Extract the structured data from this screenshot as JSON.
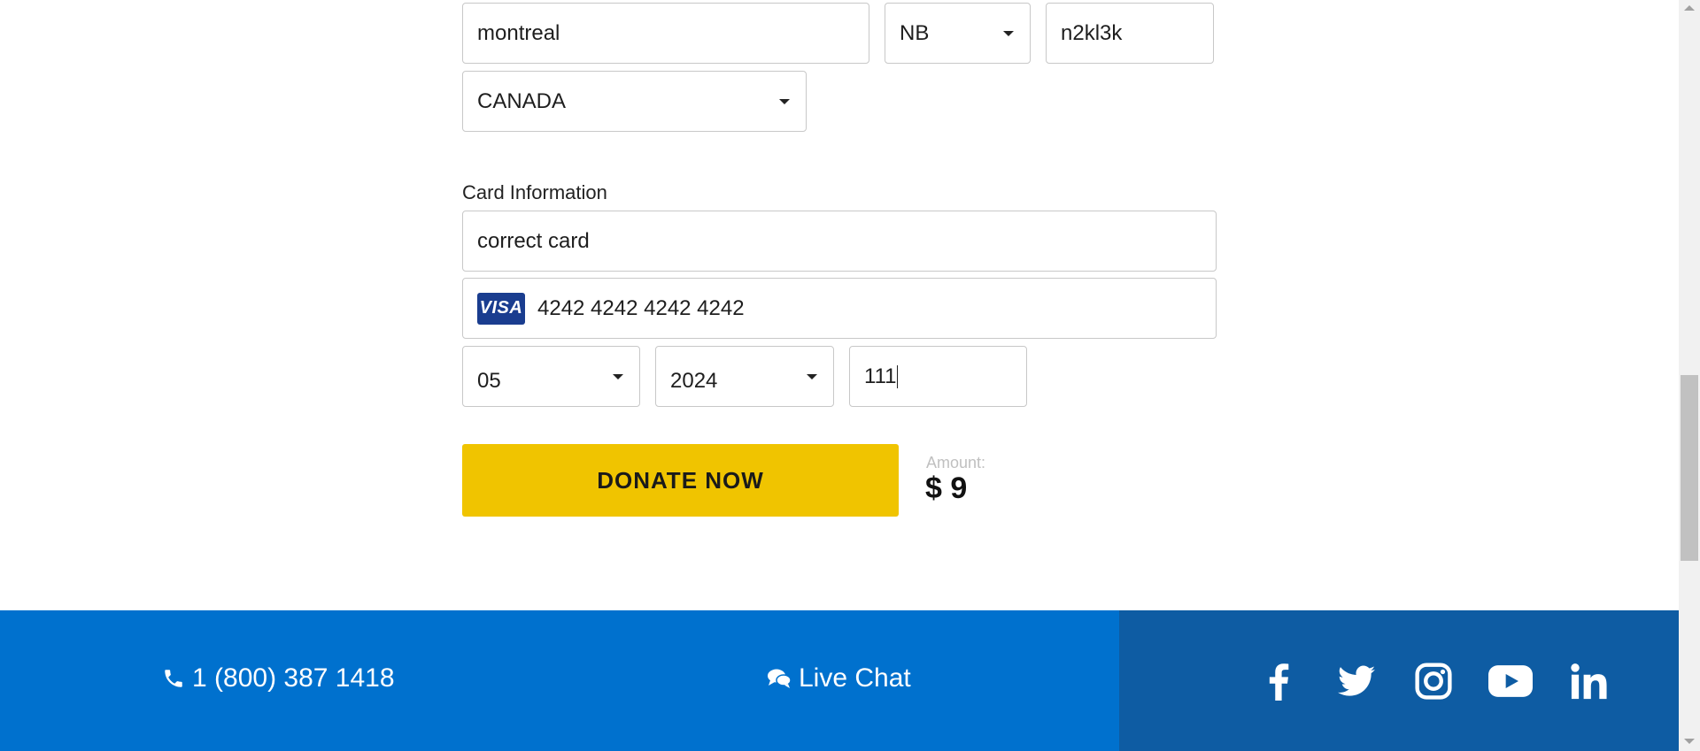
{
  "address": {
    "city": "montreal",
    "province": "NB",
    "postal_code": "n2kl3k",
    "country": "CANADA"
  },
  "card": {
    "section_label": "Card Information",
    "name": "correct card",
    "brand": "VISA",
    "number": "4242 4242 4242 4242",
    "exp_month": "05",
    "exp_year": "2024",
    "cvc": "111"
  },
  "donate": {
    "button_label": "DONATE NOW",
    "amount_label": "Amount:",
    "amount_value": "$ 9",
    "button_color": "#f0c400"
  },
  "footer": {
    "phone": "1 (800) 387 1418",
    "live_chat": "Live Chat",
    "primary_color": "#0071ce",
    "secondary_color": "#0e5ca3",
    "social": [
      "facebook-icon",
      "twitter-icon",
      "instagram-icon",
      "youtube-icon",
      "linkedin-icon"
    ]
  }
}
